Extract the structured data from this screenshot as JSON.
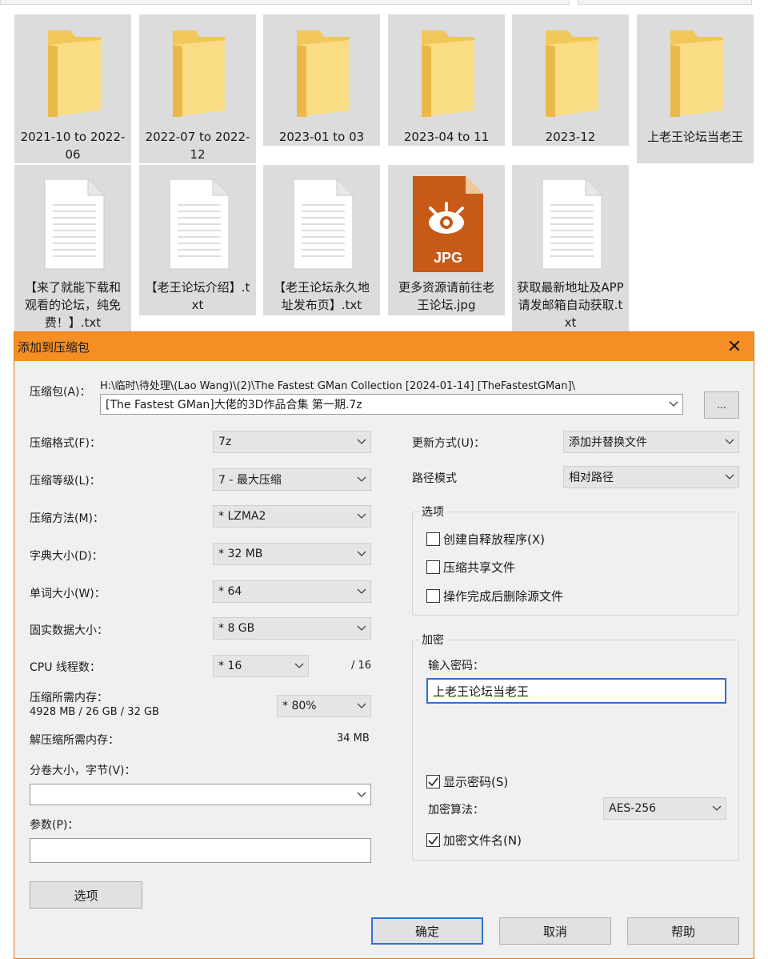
{
  "explorer": {
    "items": [
      {
        "name": "2021-10 to 2022-06",
        "type": "folder"
      },
      {
        "name": "2022-07 to 2022-12",
        "type": "folder"
      },
      {
        "name": "2023-01 to 03",
        "type": "folder"
      },
      {
        "name": "2023-04 to 11",
        "type": "folder"
      },
      {
        "name": "2023-12",
        "type": "folder"
      },
      {
        "name": "上老王论坛当老王",
        "type": "folder"
      },
      {
        "name": "【来了就能下载和观看的论坛，纯免费！】.txt",
        "type": "txt"
      },
      {
        "name": "【老王论坛介绍】.txt",
        "type": "txt"
      },
      {
        "name": "【老王论坛永久地址发布页】.txt",
        "type": "txt"
      },
      {
        "name": "更多资源请前往老王论坛.jpg",
        "type": "jpg",
        "badge": "JPG"
      },
      {
        "name": "获取最新地址及APP请发邮箱自动获取.txt",
        "type": "txt"
      }
    ]
  },
  "dialog": {
    "title": "添加到压缩包",
    "close_glyph": "✕",
    "archive": {
      "label": "压缩包(A)：",
      "path": "H:\\临时\\待处理\\(Lao Wang)\\(2)\\The Fastest GMan Collection [2024-01-14] [TheFastestGMan]\\",
      "filename": "[The Fastest GMan]大佬的3D作品合集 第一期.7z",
      "browse_label": "..."
    },
    "left": {
      "format_label": "压缩格式(F)：",
      "format_value": "7z",
      "level_label": "压缩等级(L)：",
      "level_value": "7 - 最大压缩",
      "method_label": "压缩方法(M)：",
      "method_value": "* LZMA2",
      "dict_label": "字典大小(D)：",
      "dict_value": "* 32 MB",
      "word_label": "单词大小(W)：",
      "word_value": "* 64",
      "solid_label": "固实数据大小：",
      "solid_value": "* 8 GB",
      "cpu_label": "CPU 线程数：",
      "cpu_value": "* 16",
      "cpu_total": "/ 16",
      "mem_label": "压缩所需内存：",
      "mem_detail": "4928 MB / 26 GB / 32 GB",
      "mem_value": "* 80%",
      "decomp_label": "解压缩所需内存：",
      "decomp_value": "34 MB",
      "volume_label": "分卷大小，字节(V)：",
      "volume_value": "",
      "params_label": "参数(P)：",
      "params_value": "",
      "options_button": "选项"
    },
    "right": {
      "update_label": "更新方式(U)：",
      "update_value": "添加并替换文件",
      "path_label": "路径模式",
      "path_value": "相对路径",
      "options_group": "选项",
      "opt_sfx": "创建自释放程序(X)",
      "opt_shared": "压缩共享文件",
      "opt_delete": "操作完成后删除源文件",
      "encrypt_group": "加密",
      "password_label": "输入密码：",
      "password_value": "上老王论坛当老王",
      "show_password": "显示密码(S)",
      "method_label": "加密算法：",
      "method_value": "AES-256",
      "encrypt_names": "加密文件名(N)"
    },
    "buttons": {
      "ok": "确定",
      "cancel": "取消",
      "help": "帮助"
    }
  }
}
